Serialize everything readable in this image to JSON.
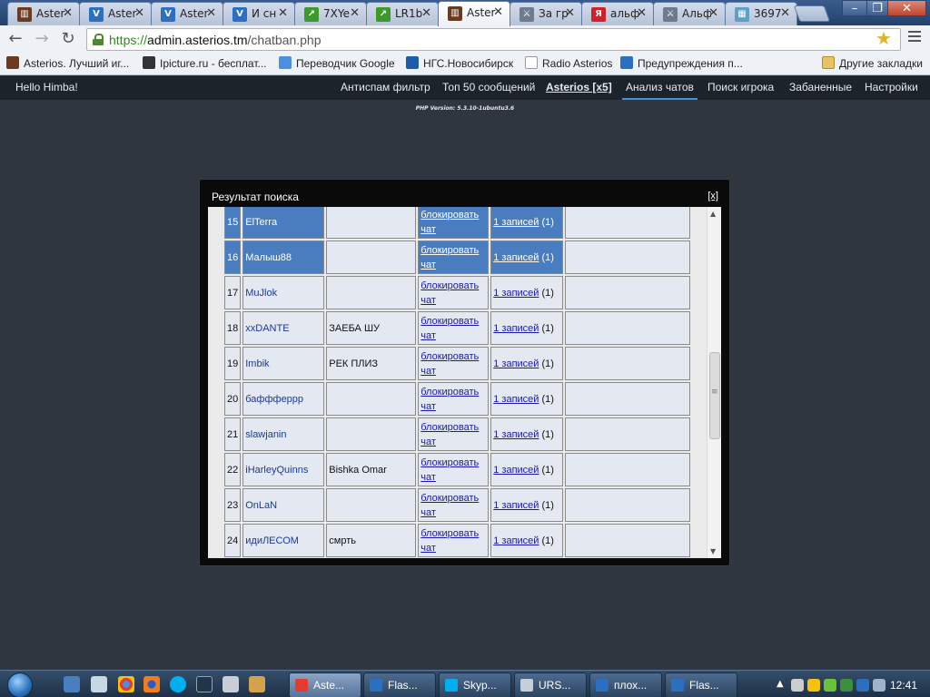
{
  "browser": {
    "tabs": [
      {
        "title": "Aster",
        "favicon": "asterios-icon"
      },
      {
        "title": "Aster",
        "favicon": "v-icon"
      },
      {
        "title": "Aster",
        "favicon": "v-icon"
      },
      {
        "title": "И сн",
        "favicon": "v-icon"
      },
      {
        "title": "7XYe",
        "favicon": "arrow-icon"
      },
      {
        "title": "LR1b",
        "favicon": "arrow-icon"
      },
      {
        "title": "Aster",
        "favicon": "asterios-icon",
        "active": true
      },
      {
        "title": "За гр",
        "favicon": "lineage-icon"
      },
      {
        "title": "альф",
        "favicon": "yandex-icon"
      },
      {
        "title": "Альф",
        "favicon": "lineage-icon"
      },
      {
        "title": "3697",
        "favicon": "image-icon"
      }
    ],
    "url": {
      "scheme": "https://",
      "host": "admin.asterios.tm",
      "path": "/chatban.php"
    },
    "bookmarks": [
      {
        "label": "Asterios. Лучший иг...",
        "icon": "asterios-icon"
      },
      {
        "label": "Ipicture.ru - бесплат...",
        "icon": "ipicture-icon"
      },
      {
        "label": "Переводчик Google",
        "icon": "translate-icon"
      },
      {
        "label": "НГС.Новосибирск",
        "icon": "ngs-icon"
      },
      {
        "label": "Radio Asterios",
        "icon": "page-icon"
      },
      {
        "label": "Предупреждения п...",
        "icon": "v-icon"
      }
    ],
    "other_bookmarks": "Другие закладки"
  },
  "site": {
    "greeting": "Hello Himba!",
    "nav": [
      {
        "label": "Антиспам фильтр"
      },
      {
        "label": "Топ 50 сообщений"
      },
      {
        "label": "Asterios [x5]",
        "bold": true
      },
      {
        "label": "Анализ чатов",
        "selected": true
      },
      {
        "label": "Поиск игрока"
      },
      {
        "label": "Забаненные"
      },
      {
        "label": "Настройки"
      }
    ],
    "php_version": "PHP Version: 5.3.10-1ubuntu3.6"
  },
  "modal": {
    "title": "Результат поиска",
    "close_label": "[x]",
    "block_label_1": "блокировать",
    "block_label_2": "чат",
    "rows": [
      {
        "num": "15",
        "nick": "ElTerra",
        "message": "",
        "records_link": "1 записей",
        "records_count": "(1)",
        "highlighted": true
      },
      {
        "num": "16",
        "nick": "Малыш88",
        "message": "",
        "records_link": "1 записей",
        "records_count": "(1)",
        "highlighted": true
      },
      {
        "num": "17",
        "nick": "MuJlok",
        "message": "",
        "records_link": "1 записей",
        "records_count": "(1)"
      },
      {
        "num": "18",
        "nick": "xxDANTE",
        "message": "ЗАЕБА ШУ",
        "records_link": "1 записей",
        "records_count": "(1)"
      },
      {
        "num": "19",
        "nick": "Imbik",
        "message": "РЕК ПЛИЗ",
        "records_link": "1 записей",
        "records_count": "(1)"
      },
      {
        "num": "20",
        "nick": "баффферрр",
        "message": "",
        "records_link": "1 записей",
        "records_count": "(1)"
      },
      {
        "num": "21",
        "nick": "slawjanin",
        "message": "",
        "records_link": "1 записей",
        "records_count": "(1)"
      },
      {
        "num": "22",
        "nick": "iHarleyQuinns",
        "message": "Bishka Omar",
        "records_link": "1 записей",
        "records_count": "(1)"
      },
      {
        "num": "23",
        "nick": "OnLaN",
        "message": "",
        "records_link": "1 записей",
        "records_count": "(1)"
      },
      {
        "num": "24",
        "nick": "идиЛЕСОМ",
        "message": "смрть",
        "records_link": "1 записей",
        "records_count": "(1)"
      }
    ]
  },
  "taskbar": {
    "tasks": [
      {
        "label": "Aste...",
        "icon": "chrome-icon",
        "active": true
      },
      {
        "label": "Flas...",
        "icon": "flash-icon"
      },
      {
        "label": "Skyp...",
        "icon": "skype-icon"
      },
      {
        "label": "URS...",
        "icon": "drive-icon"
      },
      {
        "label": "плох...",
        "icon": "flash-icon"
      },
      {
        "label": "Flas...",
        "icon": "flash-icon"
      }
    ],
    "clock": "12:41"
  }
}
